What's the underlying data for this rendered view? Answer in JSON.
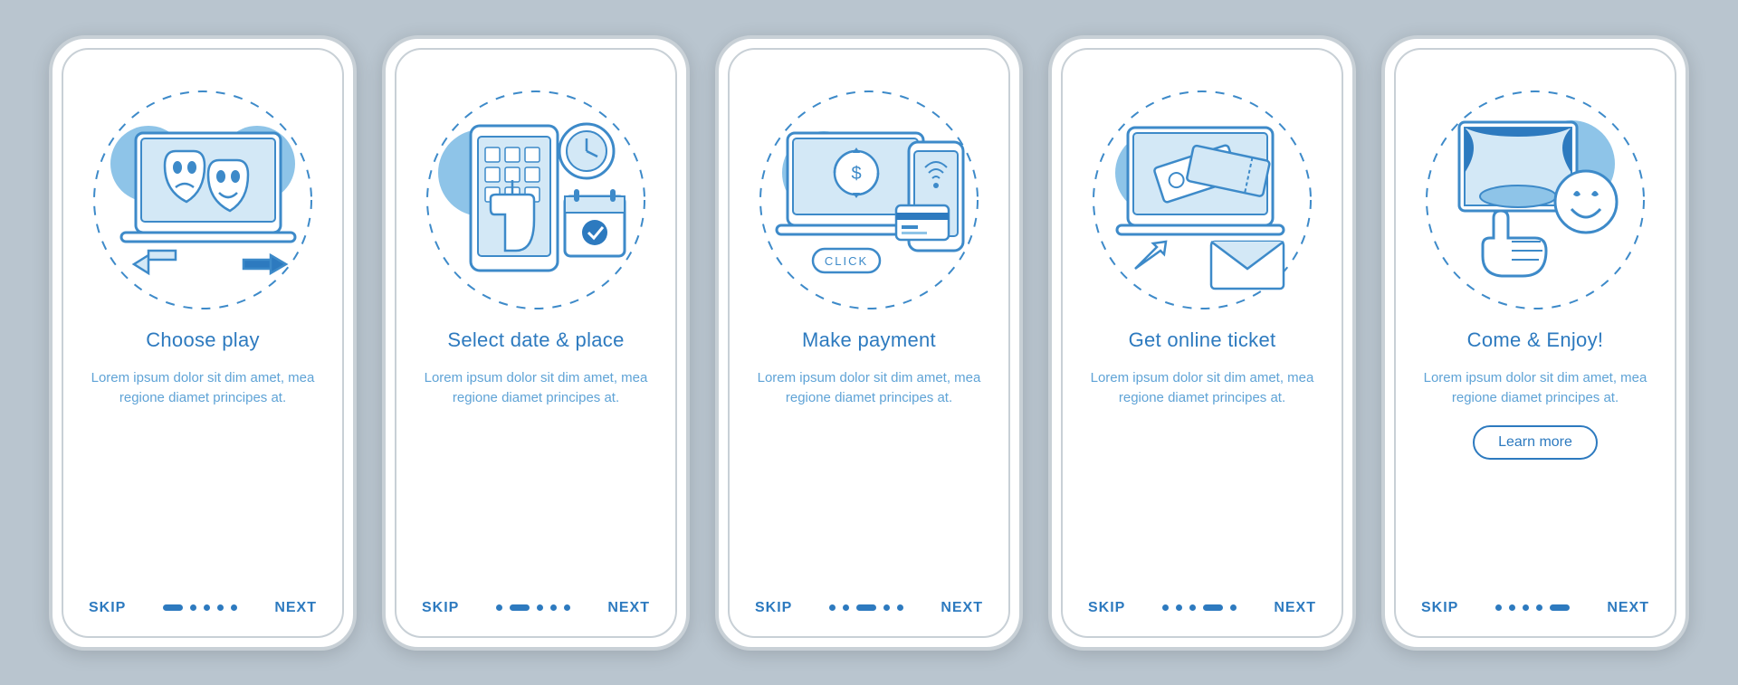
{
  "colors": {
    "primary": "#2d7abf",
    "accent": "#8ec4e8",
    "light": "#d3e8f6",
    "stroke": "#3d8ac9"
  },
  "screens": [
    {
      "title": "Choose play",
      "desc": "Lorem ipsum dolor sit dim amet, mea regione diamet principes at.",
      "skip": "SKIP",
      "next": "NEXT",
      "active": 0,
      "showLearn": false,
      "icon": "theater-masks"
    },
    {
      "title": "Select date & place",
      "desc": "Lorem ipsum dolor sit dim amet, mea regione diamet principes at.",
      "skip": "SKIP",
      "next": "NEXT",
      "active": 1,
      "showLearn": false,
      "icon": "calendar-clock"
    },
    {
      "title": "Make payment",
      "desc": "Lorem ipsum dolor sit dim amet, mea regione diamet principes at.",
      "skip": "SKIP",
      "next": "NEXT",
      "active": 2,
      "showLearn": false,
      "icon": "payment"
    },
    {
      "title": "Get online ticket",
      "desc": "Lorem ipsum dolor sit dim amet, mea regione diamet principes at.",
      "skip": "SKIP",
      "next": "NEXT",
      "active": 3,
      "showLearn": false,
      "icon": "ticket"
    },
    {
      "title": "Come & Enjoy!",
      "desc": "Lorem ipsum dolor sit dim amet, mea regione diamet principes at.",
      "skip": "SKIP",
      "next": "NEXT",
      "active": 4,
      "showLearn": true,
      "learnLabel": "Learn more",
      "icon": "enjoy"
    }
  ],
  "dotCount": 5,
  "clickLabel": "CLICK"
}
